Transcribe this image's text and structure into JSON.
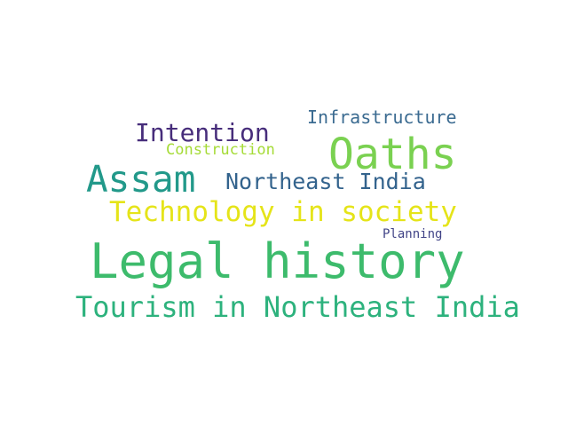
{
  "words": [
    {
      "text": "Legal history",
      "color": "#3dbb6c"
    },
    {
      "text": "Oaths",
      "color": "#7ad151"
    },
    {
      "text": "Assam",
      "color": "#22998a"
    },
    {
      "text": "Tourism in Northeast India",
      "color": "#2db27d"
    },
    {
      "text": "Technology in society",
      "color": "#e5e419"
    },
    {
      "text": "Northeast India",
      "color": "#33638d"
    },
    {
      "text": "Intention",
      "color": "#472d7b"
    },
    {
      "text": "Infrastructure",
      "color": "#3b6b91"
    },
    {
      "text": "Construction",
      "color": "#a5db36"
    },
    {
      "text": "Planning",
      "color": "#414487"
    }
  ]
}
